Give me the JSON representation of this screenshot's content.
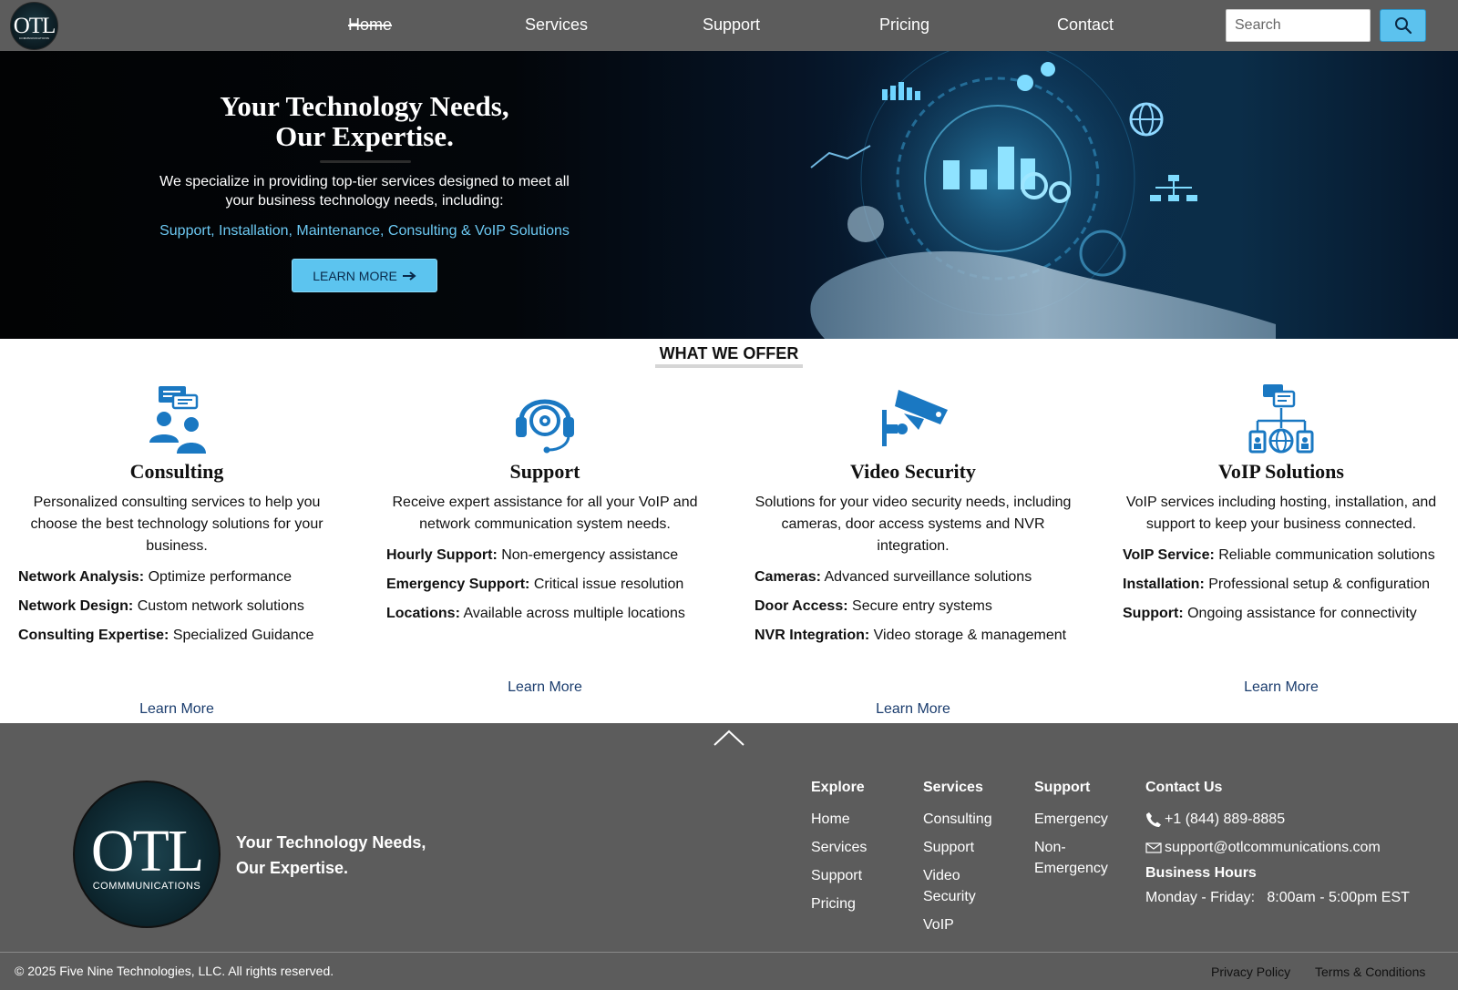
{
  "brand": {
    "logo_text": "OTL",
    "logo_subtext": "COMMMUNICATIONS"
  },
  "nav": {
    "links": [
      {
        "label": "Home"
      },
      {
        "label": "Services"
      },
      {
        "label": "Support"
      },
      {
        "label": "Pricing"
      },
      {
        "label": "Contact"
      }
    ],
    "search": {
      "placeholder": "Search",
      "button_icon": "search-icon"
    }
  },
  "hero": {
    "title_line1": "Your Technology Needs,",
    "title_line2": "Our Expertise.",
    "text": "We specialize in providing top-tier services designed to meet all your business technology needs, including:",
    "services": "Support, Installation, Maintenance, Consulting & VoIP Solutions",
    "button_label": "LEARN MORE",
    "button_icon": "arrow-right-icon"
  },
  "offer": {
    "heading": "WHAT WE OFFER",
    "cards": [
      {
        "icon": "consulting-people-chat-icon",
        "title": "Consulting",
        "description": "Personalized consulting services to help you choose the best technology solutions for your business.",
        "items": [
          {
            "label": "Network Analysis:",
            "text": "Optimize performance"
          },
          {
            "label": "Network Design:",
            "text": "Custom network solutions"
          },
          {
            "label": "Consulting Expertise:",
            "text": "Specialized Guidance"
          }
        ],
        "link": "Learn More"
      },
      {
        "icon": "headset-support-icon",
        "title": "Support",
        "description": "Receive expert assistance for all your VoIP and network communication system needs.",
        "items": [
          {
            "label": "Hourly Support:",
            "text": "Non-emergency assistance"
          },
          {
            "label": "Emergency Support:",
            "text": "Critical issue resolution"
          },
          {
            "label": "Locations:",
            "text": "Available across multiple locations"
          }
        ],
        "link": "Learn More"
      },
      {
        "icon": "security-camera-icon",
        "title": "Video Security",
        "description": "Solutions for your video security needs, including cameras, door access systems and NVR integration.",
        "items": [
          {
            "label": "Cameras:",
            "text": "Advanced surveillance solutions"
          },
          {
            "label": "Door Access:",
            "text": "Secure entry systems"
          },
          {
            "label": "NVR Integration:",
            "text": "Video storage & management"
          }
        ],
        "link": "Learn More"
      },
      {
        "icon": "voip-network-icon",
        "title": "VoIP Solutions",
        "description": "VoIP services including hosting, installation, and support to keep your business connected.",
        "items": [
          {
            "label": "VoIP Service:",
            "text": "Reliable communication solutions"
          },
          {
            "label": "Installation:",
            "text": "Professional setup & configuration"
          },
          {
            "label": "Support:",
            "text": "Ongoing assistance for connectivity"
          }
        ],
        "link": "Learn More"
      }
    ]
  },
  "footer": {
    "logo_text": "OTL",
    "logo_subtext": "COMMMUNICATIONS",
    "tagline_line1": "Your Technology Needs,",
    "tagline_line2": "Our Expertise.",
    "columns": {
      "explore": {
        "heading": "Explore",
        "links": [
          "Home",
          "Services",
          "Support",
          "Pricing"
        ]
      },
      "services": {
        "heading": "Services",
        "links": [
          "Consulting",
          "Support",
          "Video Security",
          "VoIP"
        ]
      },
      "support": {
        "heading": "Support",
        "links": [
          "Emergency",
          "Non-Emergency"
        ]
      }
    },
    "contact": {
      "heading": "Contact Us",
      "phone": "+1 (844) 889-8885",
      "email": "support@otlcommunications.com",
      "hours_heading": "Business Hours",
      "hours": "Monday - Friday:   8:00am - 5:00pm EST"
    },
    "copyright": "© 2025 Five Nine Technologies, LLC. All rights reserved.",
    "legal": [
      "Privacy Policy",
      "Terms & Conditions"
    ]
  },
  "colors": {
    "nav_bg": "#5c5c5c",
    "accent": "#5cc2ee",
    "link_blue": "#1b3d6e",
    "icon_blue": "#1a78c2",
    "footer_bg": "#5c5c5c"
  }
}
